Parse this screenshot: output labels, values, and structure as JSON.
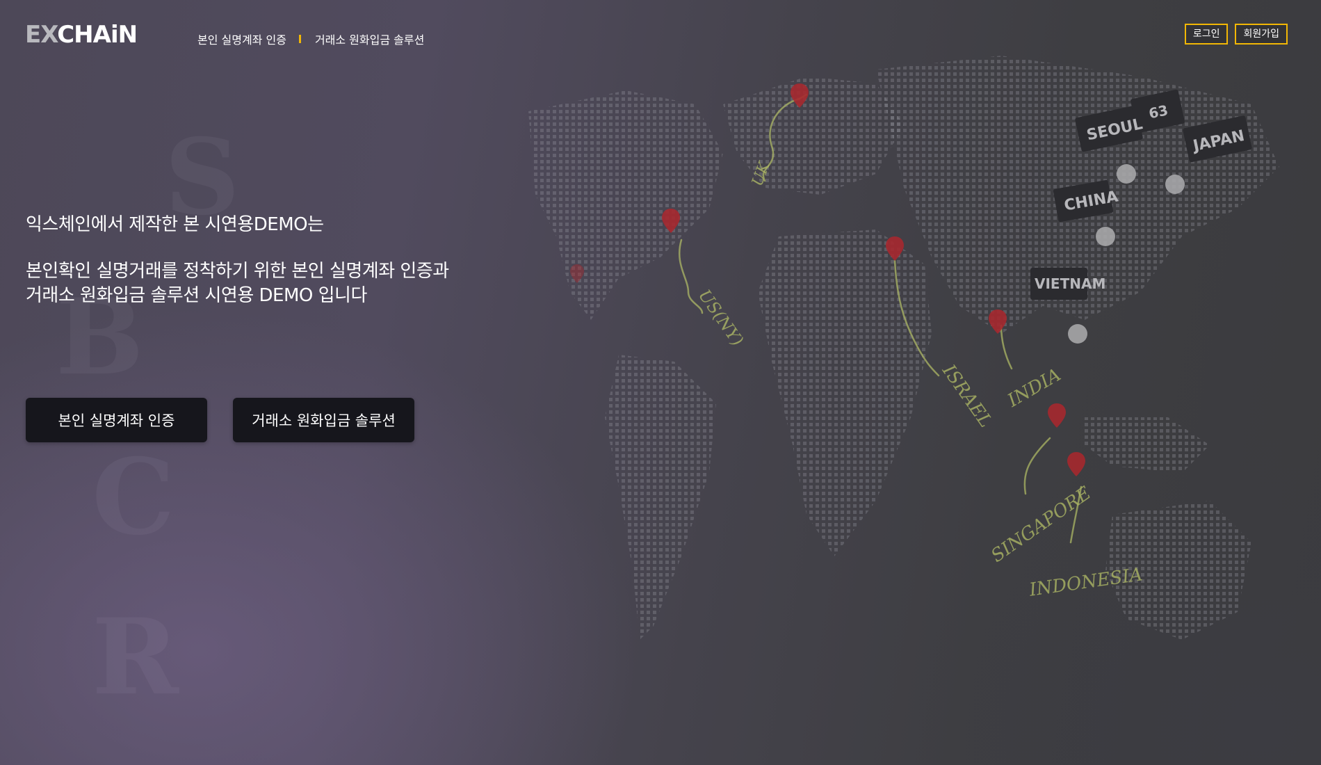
{
  "brand": {
    "logo_ex": "EX",
    "logo_rest": "CHAiN"
  },
  "nav": {
    "items": [
      {
        "label": "본인 실명계좌 인증"
      },
      {
        "label": "거래소 원화입금 솔루션"
      }
    ]
  },
  "auth": {
    "login_label": "로그인",
    "signup_label": "회원가입"
  },
  "hero": {
    "line1": "익스체인에서 제작한 본 시연용DEMO는",
    "line2": "본인확인 실명거래를 정착하기 위한 본인 실명계좌 인증과",
    "line3": "거래소 원화입금 솔루션 시연용 DEMO 입니다"
  },
  "cta": {
    "primary_label": "본인 실명계좌 인증",
    "secondary_label": "거래소 원화입금 솔루션"
  },
  "map": {
    "labels": {
      "seoul": "SEOUL",
      "seoul_num": "63",
      "japan": "JAPAN",
      "china": "CHINA",
      "vietnam": "VIETNAM",
      "israel": "ISRAEL",
      "india": "INDIA",
      "singapore": "SINGAPORE",
      "indonesia": "INDONESIA",
      "us": "US(NY)",
      "uk": "UK"
    }
  },
  "colors": {
    "accent": "#f2b705",
    "button_bg": "#16161c",
    "pin_red": "#b3262c",
    "tag_bg": "#2a2a2e",
    "handwriting": "#b9c46a"
  }
}
